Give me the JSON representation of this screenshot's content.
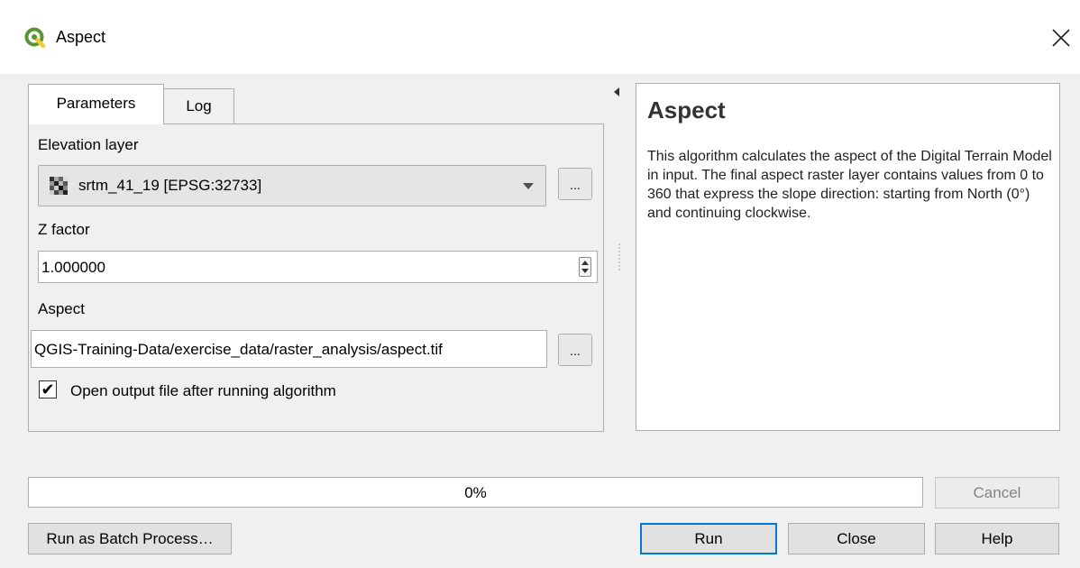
{
  "window": {
    "title": "Aspect",
    "close_glyph": "✕"
  },
  "tabs": [
    {
      "label": "Parameters"
    },
    {
      "label": "Log"
    }
  ],
  "params": {
    "elevation_label": "Elevation layer",
    "elevation_value": "srtm_41_19 [EPSG:32733]",
    "zfactor_label": "Z factor",
    "zfactor_value": "1.000000",
    "aspect_label": "Aspect",
    "aspect_value": "QGIS-Training-Data/exercise_data/raster_analysis/aspect.tif",
    "browse_label": "...",
    "open_output_label": "Open output file after running algorithm",
    "open_output_checked": true,
    "check_glyph": "✔"
  },
  "help": {
    "title": "Aspect",
    "description": "This algorithm calculates the aspect of the Digital Terrain Model in input. The final aspect raster layer contains values from 0 to 360 that express the slope direction: starting from North (0°) and continuing clockwise."
  },
  "progress": {
    "value": 0,
    "label": "0%"
  },
  "buttons": {
    "cancel": "Cancel",
    "batch": "Run as Batch Process…",
    "run": "Run",
    "close": "Close",
    "help": "Help"
  },
  "colors": {
    "accent": "#0078d7",
    "qgis_green": "#589632",
    "qgis_yellow": "#f0cc42"
  },
  "icons": {
    "app": "qgis-logo-icon",
    "layer": "raster-layer-icon",
    "close": "close-icon"
  }
}
